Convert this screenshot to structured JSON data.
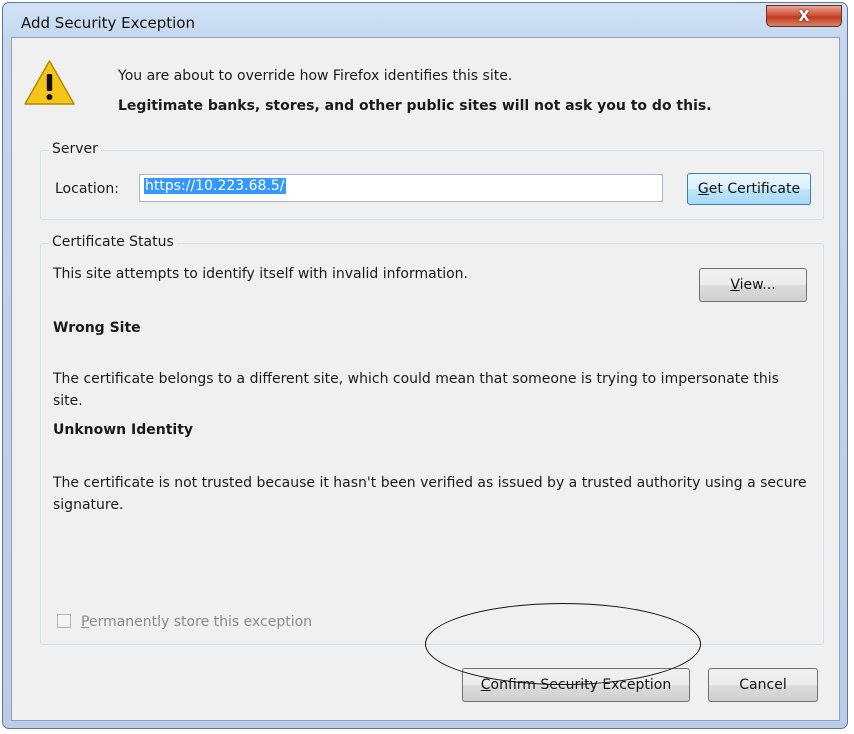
{
  "window": {
    "title": "Add Security Exception",
    "close_label": "X"
  },
  "intro": {
    "line1": "You are about to override how Firefox identifies this site.",
    "line2": "Legitimate banks, stores, and other public sites will not ask you to do this."
  },
  "server": {
    "legend": "Server",
    "location_label": "Location:",
    "location_value": "https://10.223.68.5/",
    "get_certificate_rest": "et Certificate",
    "get_certificate_accel": "G"
  },
  "status": {
    "legend": "Certificate Status",
    "summary": "This site attempts to identify itself with invalid information.",
    "view_accel": "V",
    "view_rest": "iew...",
    "wrong_site_title": "Wrong Site",
    "wrong_site_text": "The certificate belongs to a different site, which could mean that someone is trying to impersonate this site.",
    "unknown_identity_title": "Unknown Identity",
    "unknown_identity_text": "The certificate is not trusted because it hasn't been verified as issued by a trusted authority using a secure signature."
  },
  "permanent": {
    "accel": "P",
    "rest": "ermanently store this exception",
    "checked": false
  },
  "buttons": {
    "confirm_accel": "C",
    "confirm_rest": "onfirm Security Exception",
    "cancel": "Cancel"
  },
  "colors": {
    "selection": "#3399ff",
    "warning_icon": "#f5c518"
  }
}
